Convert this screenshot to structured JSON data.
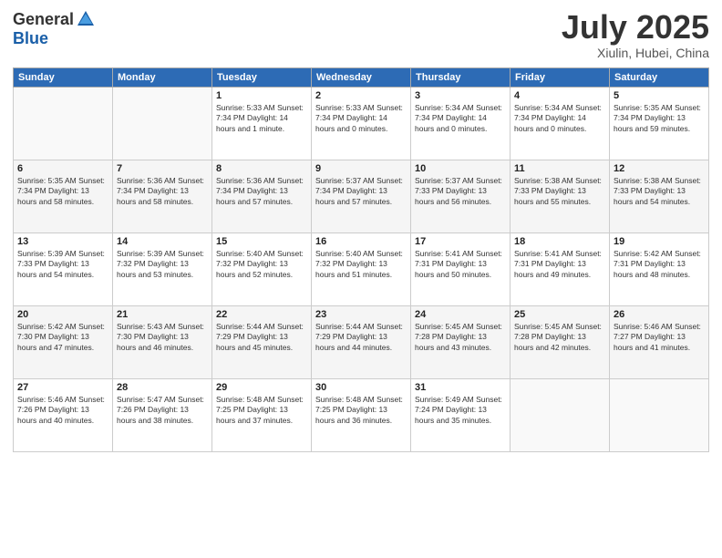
{
  "header": {
    "logo_general": "General",
    "logo_blue": "Blue",
    "month_title": "July 2025",
    "location": "Xiulin, Hubei, China"
  },
  "weekdays": [
    "Sunday",
    "Monday",
    "Tuesday",
    "Wednesday",
    "Thursday",
    "Friday",
    "Saturday"
  ],
  "weeks": [
    [
      {
        "day": "",
        "detail": ""
      },
      {
        "day": "",
        "detail": ""
      },
      {
        "day": "1",
        "detail": "Sunrise: 5:33 AM\nSunset: 7:34 PM\nDaylight: 14 hours\nand 1 minute."
      },
      {
        "day": "2",
        "detail": "Sunrise: 5:33 AM\nSunset: 7:34 PM\nDaylight: 14 hours\nand 0 minutes."
      },
      {
        "day": "3",
        "detail": "Sunrise: 5:34 AM\nSunset: 7:34 PM\nDaylight: 14 hours\nand 0 minutes."
      },
      {
        "day": "4",
        "detail": "Sunrise: 5:34 AM\nSunset: 7:34 PM\nDaylight: 14 hours\nand 0 minutes."
      },
      {
        "day": "5",
        "detail": "Sunrise: 5:35 AM\nSunset: 7:34 PM\nDaylight: 13 hours\nand 59 minutes."
      }
    ],
    [
      {
        "day": "6",
        "detail": "Sunrise: 5:35 AM\nSunset: 7:34 PM\nDaylight: 13 hours\nand 58 minutes."
      },
      {
        "day": "7",
        "detail": "Sunrise: 5:36 AM\nSunset: 7:34 PM\nDaylight: 13 hours\nand 58 minutes."
      },
      {
        "day": "8",
        "detail": "Sunrise: 5:36 AM\nSunset: 7:34 PM\nDaylight: 13 hours\nand 57 minutes."
      },
      {
        "day": "9",
        "detail": "Sunrise: 5:37 AM\nSunset: 7:34 PM\nDaylight: 13 hours\nand 57 minutes."
      },
      {
        "day": "10",
        "detail": "Sunrise: 5:37 AM\nSunset: 7:33 PM\nDaylight: 13 hours\nand 56 minutes."
      },
      {
        "day": "11",
        "detail": "Sunrise: 5:38 AM\nSunset: 7:33 PM\nDaylight: 13 hours\nand 55 minutes."
      },
      {
        "day": "12",
        "detail": "Sunrise: 5:38 AM\nSunset: 7:33 PM\nDaylight: 13 hours\nand 54 minutes."
      }
    ],
    [
      {
        "day": "13",
        "detail": "Sunrise: 5:39 AM\nSunset: 7:33 PM\nDaylight: 13 hours\nand 54 minutes."
      },
      {
        "day": "14",
        "detail": "Sunrise: 5:39 AM\nSunset: 7:32 PM\nDaylight: 13 hours\nand 53 minutes."
      },
      {
        "day": "15",
        "detail": "Sunrise: 5:40 AM\nSunset: 7:32 PM\nDaylight: 13 hours\nand 52 minutes."
      },
      {
        "day": "16",
        "detail": "Sunrise: 5:40 AM\nSunset: 7:32 PM\nDaylight: 13 hours\nand 51 minutes."
      },
      {
        "day": "17",
        "detail": "Sunrise: 5:41 AM\nSunset: 7:31 PM\nDaylight: 13 hours\nand 50 minutes."
      },
      {
        "day": "18",
        "detail": "Sunrise: 5:41 AM\nSunset: 7:31 PM\nDaylight: 13 hours\nand 49 minutes."
      },
      {
        "day": "19",
        "detail": "Sunrise: 5:42 AM\nSunset: 7:31 PM\nDaylight: 13 hours\nand 48 minutes."
      }
    ],
    [
      {
        "day": "20",
        "detail": "Sunrise: 5:42 AM\nSunset: 7:30 PM\nDaylight: 13 hours\nand 47 minutes."
      },
      {
        "day": "21",
        "detail": "Sunrise: 5:43 AM\nSunset: 7:30 PM\nDaylight: 13 hours\nand 46 minutes."
      },
      {
        "day": "22",
        "detail": "Sunrise: 5:44 AM\nSunset: 7:29 PM\nDaylight: 13 hours\nand 45 minutes."
      },
      {
        "day": "23",
        "detail": "Sunrise: 5:44 AM\nSunset: 7:29 PM\nDaylight: 13 hours\nand 44 minutes."
      },
      {
        "day": "24",
        "detail": "Sunrise: 5:45 AM\nSunset: 7:28 PM\nDaylight: 13 hours\nand 43 minutes."
      },
      {
        "day": "25",
        "detail": "Sunrise: 5:45 AM\nSunset: 7:28 PM\nDaylight: 13 hours\nand 42 minutes."
      },
      {
        "day": "26",
        "detail": "Sunrise: 5:46 AM\nSunset: 7:27 PM\nDaylight: 13 hours\nand 41 minutes."
      }
    ],
    [
      {
        "day": "27",
        "detail": "Sunrise: 5:46 AM\nSunset: 7:26 PM\nDaylight: 13 hours\nand 40 minutes."
      },
      {
        "day": "28",
        "detail": "Sunrise: 5:47 AM\nSunset: 7:26 PM\nDaylight: 13 hours\nand 38 minutes."
      },
      {
        "day": "29",
        "detail": "Sunrise: 5:48 AM\nSunset: 7:25 PM\nDaylight: 13 hours\nand 37 minutes."
      },
      {
        "day": "30",
        "detail": "Sunrise: 5:48 AM\nSunset: 7:25 PM\nDaylight: 13 hours\nand 36 minutes."
      },
      {
        "day": "31",
        "detail": "Sunrise: 5:49 AM\nSunset: 7:24 PM\nDaylight: 13 hours\nand 35 minutes."
      },
      {
        "day": "",
        "detail": ""
      },
      {
        "day": "",
        "detail": ""
      }
    ]
  ]
}
